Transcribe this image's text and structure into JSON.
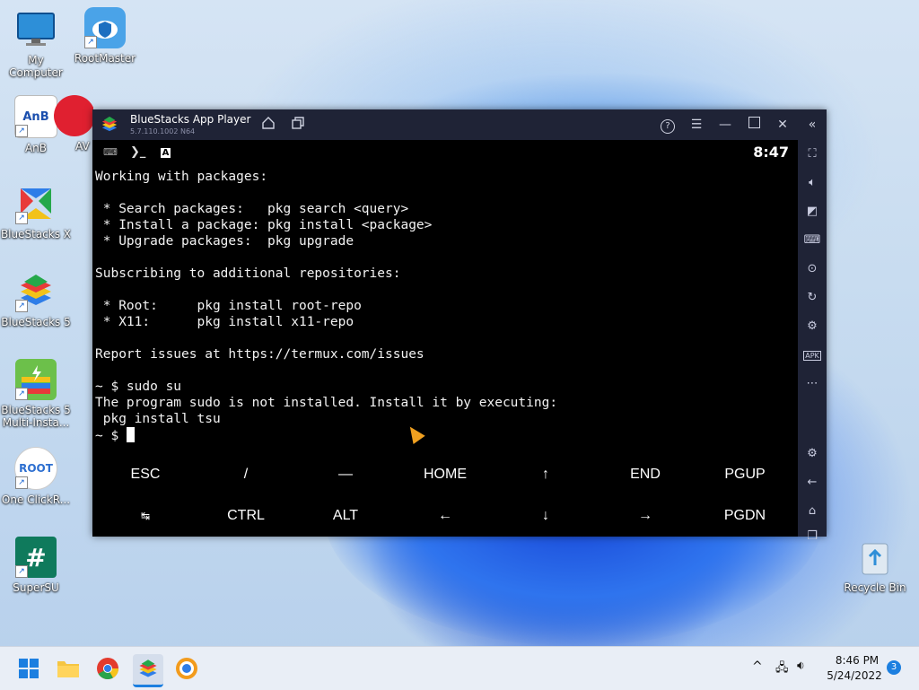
{
  "desktop": {
    "icons": [
      {
        "label": "My Computer",
        "icon": "monitor-icon"
      },
      {
        "label": "RootMaster",
        "icon": "shield-cloud-icon"
      },
      {
        "label": "AnB",
        "icon": "anb-icon",
        "glyph": "AnB"
      },
      {
        "label": "AV",
        "icon": "app-icon"
      },
      {
        "label": "BlueStacks X",
        "icon": "bluestacks-x-icon"
      },
      {
        "label": "BlueStacks 5",
        "icon": "bluestacks-icon"
      },
      {
        "label": "BlueStacks 5 Multi-Insta...",
        "icon": "bluestacks-multi-icon"
      },
      {
        "label": "One ClickR...",
        "icon": "root-icon",
        "glyph": "ROOT"
      },
      {
        "label": "SuperSU",
        "icon": "hash-icon",
        "glyph": "#"
      },
      {
        "label": "Recycle Bin",
        "icon": "recycle-bin-icon"
      }
    ]
  },
  "window": {
    "title": "BlueStacks App Player",
    "version": "5.7.110.1002 N64"
  },
  "statusbar": {
    "time": "8:47",
    "prompt_glyph": "❯_",
    "a_glyph": "A"
  },
  "terminal": {
    "lines": [
      "Working with packages:",
      "",
      " * Search packages:   pkg search <query>",
      " * Install a package: pkg install <package>",
      " * Upgrade packages:  pkg upgrade",
      "",
      "Subscribing to additional repositories:",
      "",
      " * Root:     pkg install root-repo",
      " * X11:      pkg install x11-repo",
      "",
      "Report issues at https://termux.com/issues",
      "",
      "~ $ sudo su",
      "The program sudo is not installed. Install it by executing:",
      " pkg install tsu"
    ],
    "prompt": "~ $ "
  },
  "extra_keys": {
    "row1": [
      "ESC",
      "/",
      "—",
      "HOME",
      "↑",
      "END",
      "PGUP"
    ],
    "row2": [
      "↹",
      "CTRL",
      "ALT",
      "←",
      "↓",
      "→",
      "PGDN"
    ]
  },
  "taskbar": {
    "time": "8:46 PM",
    "date": "5/24/2022",
    "notifications": "3"
  }
}
